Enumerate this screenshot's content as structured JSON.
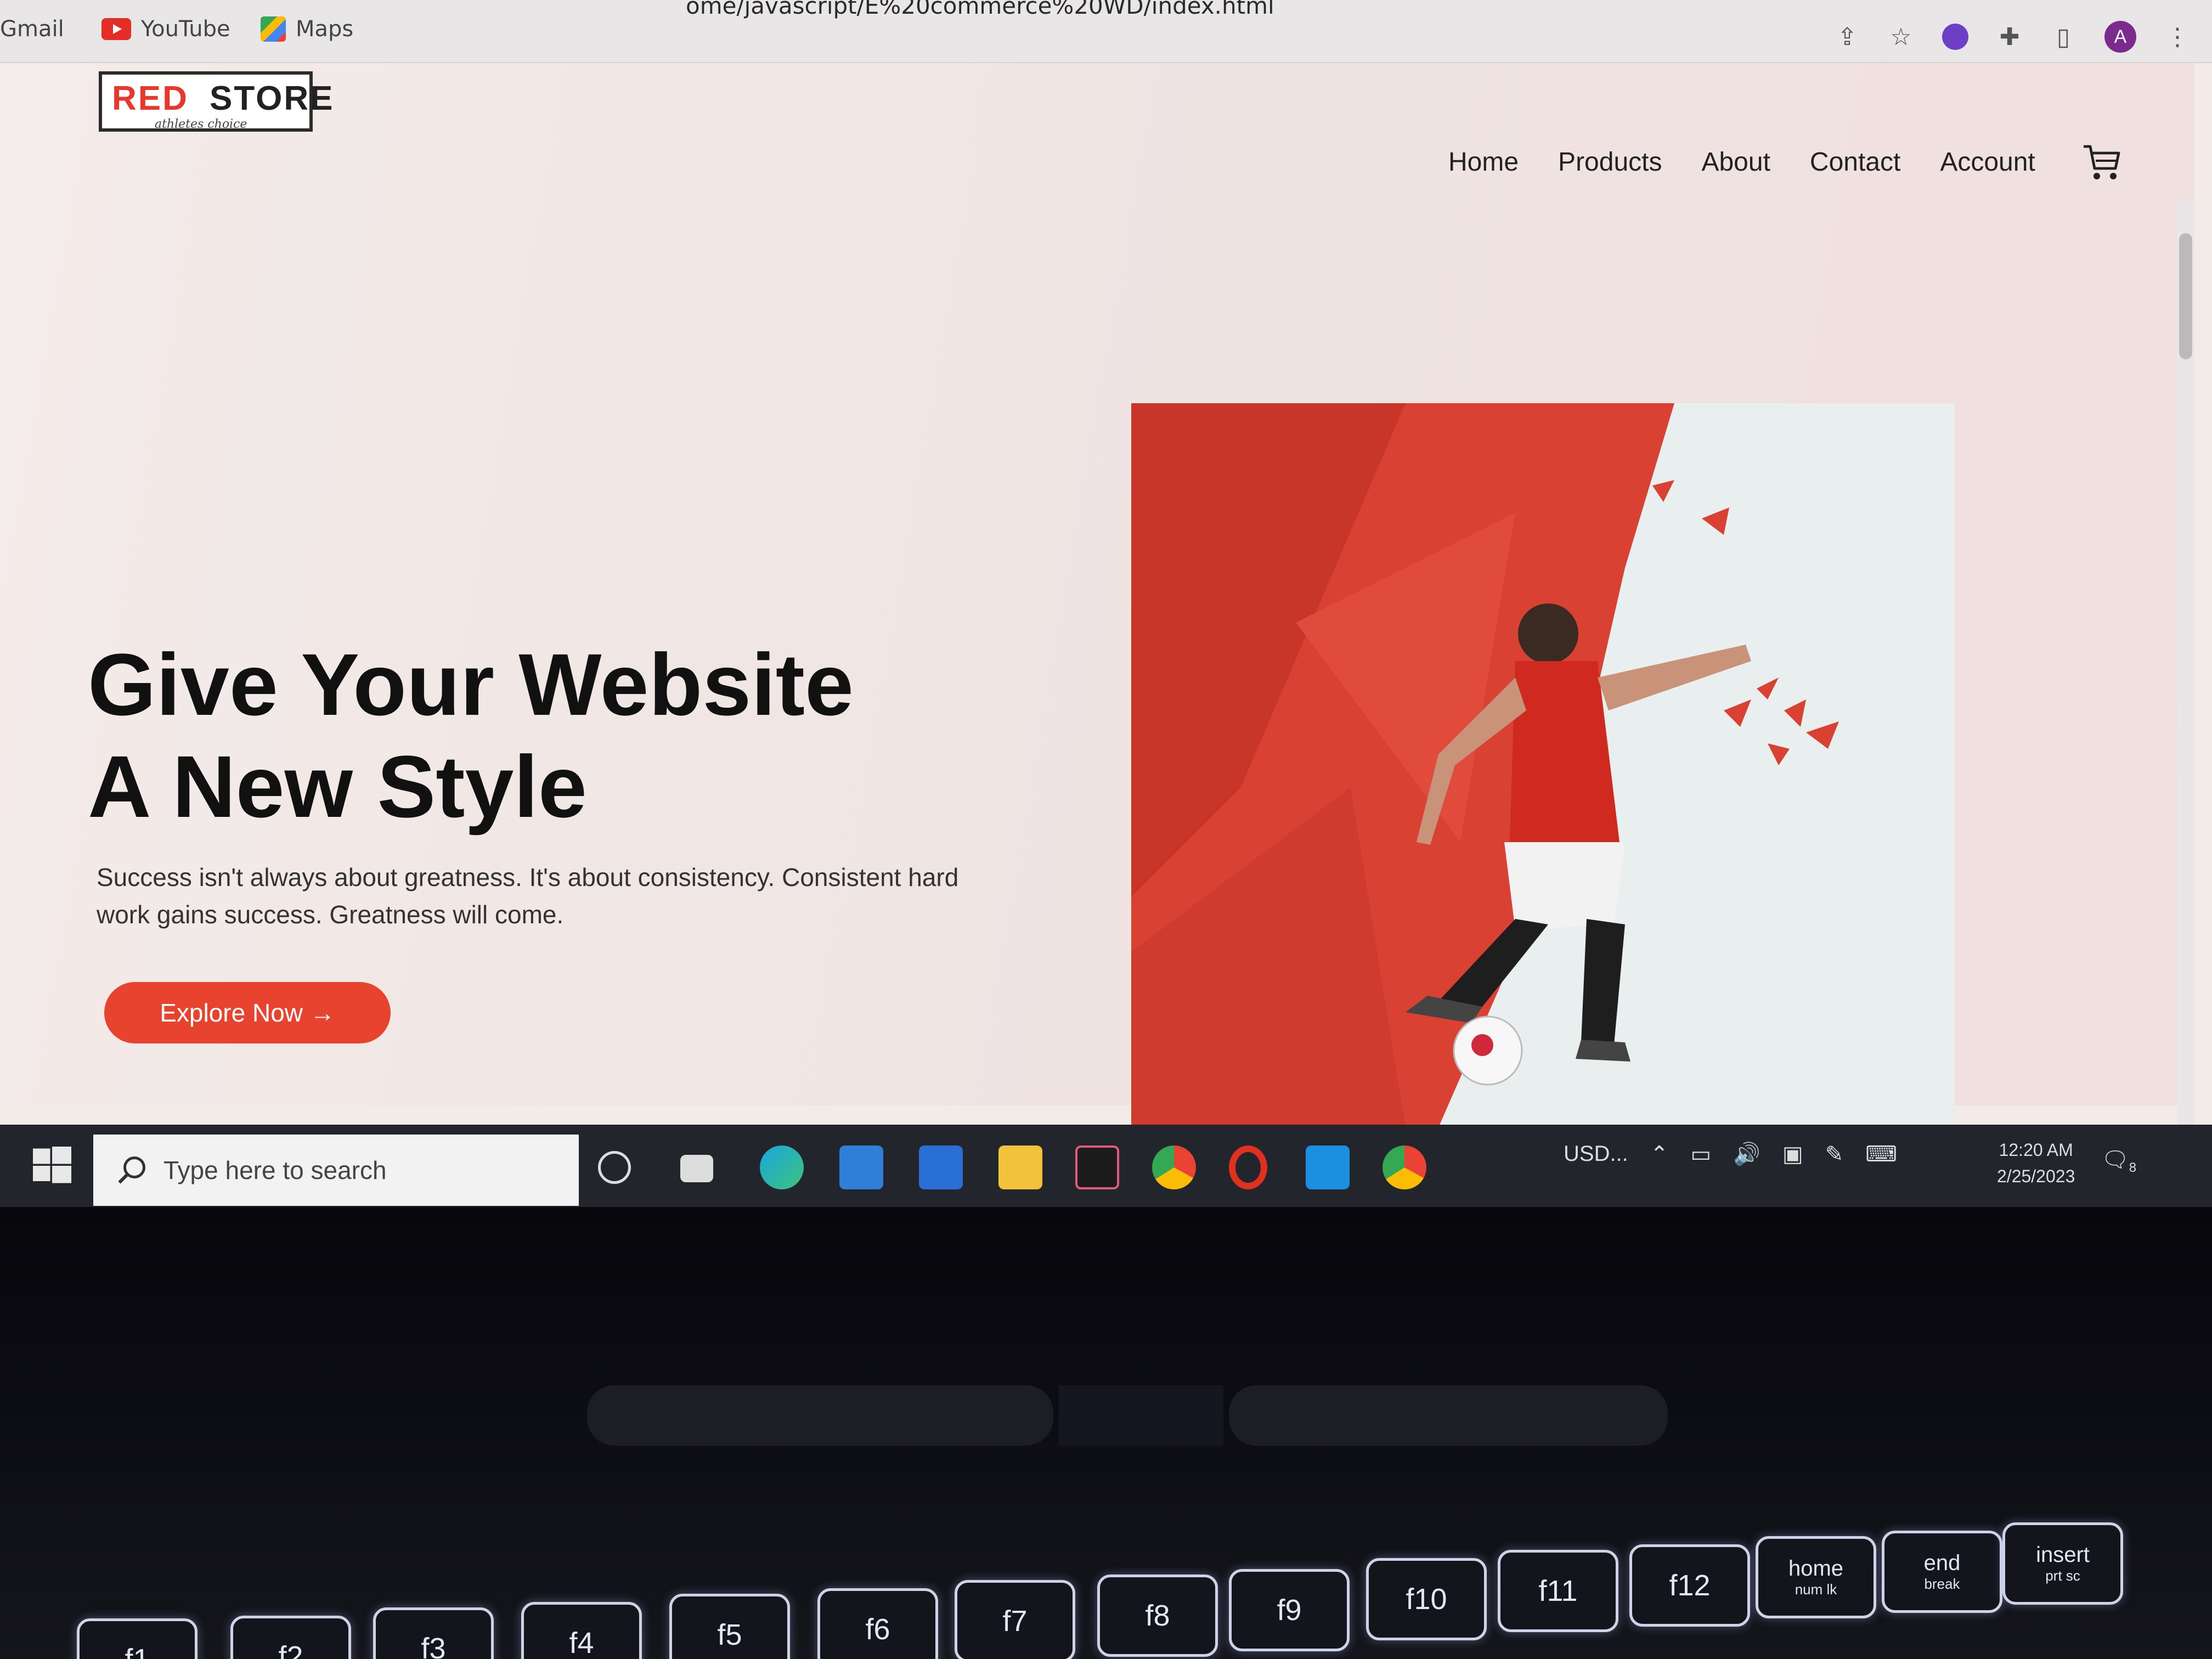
{
  "browser": {
    "url": "ome/javascript/E%20commerce%20WD/index.html",
    "bookmarks": [
      {
        "label": "Gmail",
        "icon": "gmail-icon"
      },
      {
        "label": "YouTube",
        "icon": "youtube-icon"
      },
      {
        "label": "Maps",
        "icon": "maps-icon"
      }
    ],
    "profile_initial": "A"
  },
  "site": {
    "logo": {
      "red": "RED",
      "black": "STORE",
      "tagline": "athletes choice"
    },
    "nav": [
      "Home",
      "Products",
      "About",
      "Contact",
      "Account"
    ],
    "hero": {
      "title_line1": "Give Your Website",
      "title_line2": "A New Style",
      "text": "Success isn't always about greatness. It's about consistency. Consistent hard work gains success. Greatness will come.",
      "button": "Explore Now →"
    },
    "colors": {
      "accent": "#e8432f",
      "hero_red": "#d94132"
    }
  },
  "taskbar": {
    "search_placeholder": "Type here to search",
    "tray_currency": "USD...",
    "time": "12:20 AM",
    "date": "2/25/2023",
    "notification_count": "8"
  },
  "keyboard": {
    "keys": [
      "f1",
      "f2",
      "f3",
      "f4",
      "f5",
      "f6",
      "f7",
      "f8",
      "f9",
      "f10",
      "f11",
      "f12",
      "home",
      "end",
      "insert"
    ],
    "sublabels": {
      "home": "num lk",
      "end": "break",
      "insert": "prt sc"
    }
  }
}
